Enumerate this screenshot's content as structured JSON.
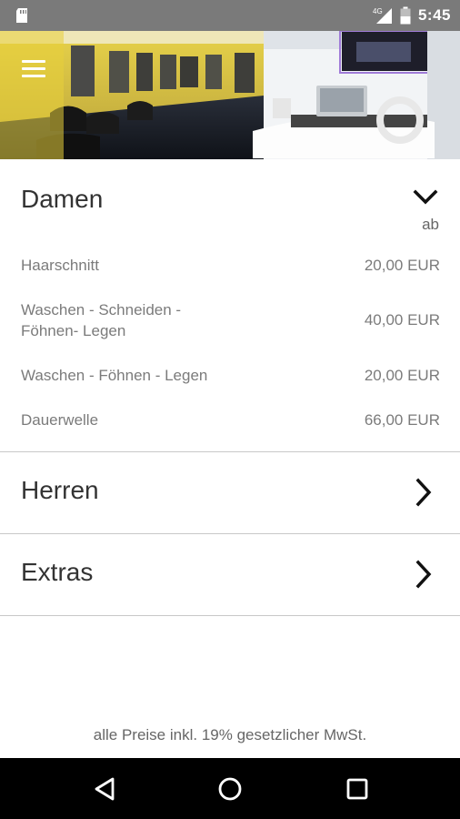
{
  "status_bar": {
    "time": "5:45",
    "network": "4G",
    "icons": [
      "sd-card-icon",
      "signal-icon",
      "battery-icon"
    ]
  },
  "header": {
    "menu_icon": "hamburger-menu-icon",
    "image_alt": "salon interior photo"
  },
  "sections": [
    {
      "title": "Damen",
      "expanded": true,
      "price_hint": "ab",
      "items": [
        {
          "name": "Haarschnitt",
          "price": "20,00 EUR"
        },
        {
          "name": "Waschen - Schneiden -\nFöhnen- Legen",
          "price": "40,00 EUR"
        },
        {
          "name": "Waschen - Föhnen - Legen",
          "price": "20,00 EUR"
        },
        {
          "name": "Dauerwelle",
          "price": "66,00 EUR"
        }
      ]
    },
    {
      "title": "Herren",
      "expanded": false
    },
    {
      "title": "Extras",
      "expanded": false
    }
  ],
  "footer_note": "alle Preise inkl. 19% gesetzlicher MwSt.",
  "nav_bar": {
    "back_icon": "back-triangle-icon",
    "home_icon": "home-circle-icon",
    "recents_icon": "recents-square-icon"
  }
}
